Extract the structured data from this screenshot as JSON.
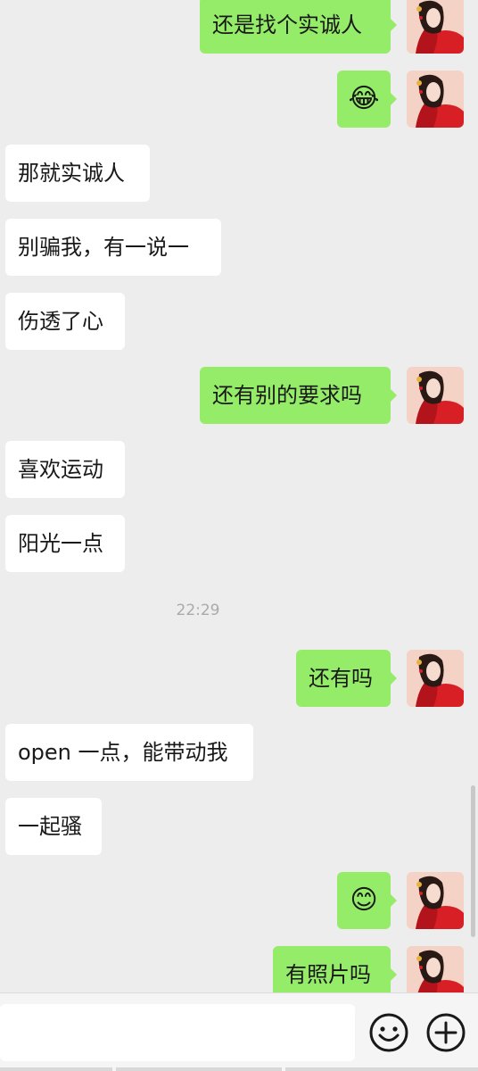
{
  "messages": [
    {
      "text": "还是找个实诚人",
      "sender": "me"
    },
    {
      "text": "😂",
      "sender": "me",
      "type": "emoji"
    },
    {
      "text": "那就实诚人",
      "sender": "them"
    },
    {
      "text": "别骗我，有一说一",
      "sender": "them"
    },
    {
      "text": "伤透了心",
      "sender": "them"
    },
    {
      "text": "还有别的要求吗",
      "sender": "me"
    },
    {
      "text": "喜欢运动",
      "sender": "them"
    },
    {
      "text": "阳光一点",
      "sender": "them"
    },
    {
      "text": "还有吗",
      "sender": "me"
    },
    {
      "text": "open 一点，能带动我",
      "sender": "them"
    },
    {
      "text": "一起骚",
      "sender": "them"
    },
    {
      "text": "😊",
      "sender": "me",
      "type": "emoji"
    },
    {
      "text": "有照片吗",
      "sender": "me"
    }
  ],
  "timestamp": "22:29",
  "input_bar": {
    "emoji_icon": "smiley-face-icon",
    "plus_icon": "plus-circle-icon"
  },
  "colors": {
    "background": "#ededed",
    "my_bubble": "#95ec69",
    "their_bubble": "#ffffff"
  }
}
